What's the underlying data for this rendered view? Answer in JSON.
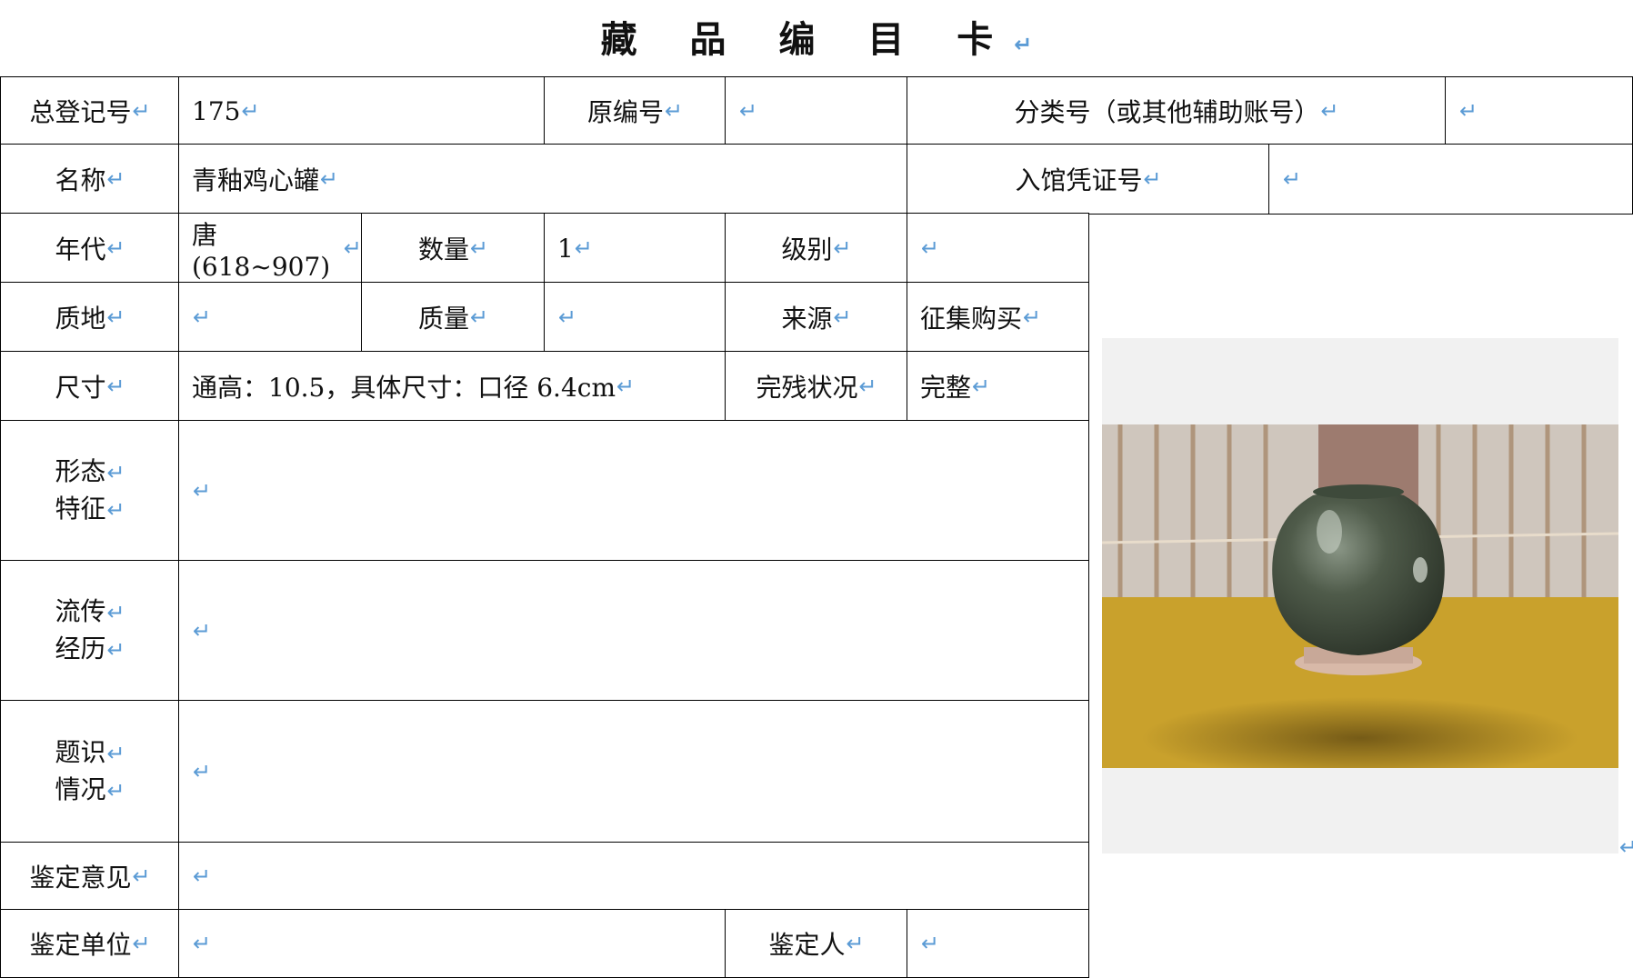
{
  "title": "藏 品 编 目 卡",
  "return_mark": "↵",
  "fields": {
    "registration_no": {
      "label": "总登记号",
      "value": "175"
    },
    "original_no": {
      "label": "原编号",
      "value": ""
    },
    "classification_no": {
      "label": "分类号（或其他辅助账号）",
      "value": ""
    },
    "name": {
      "label": "名称",
      "value": "青釉鸡心罐"
    },
    "entry_voucher_no": {
      "label": "入馆凭证号",
      "value": ""
    },
    "era": {
      "label": "年代",
      "value": "唐(618~907)"
    },
    "quantity": {
      "label": "数量",
      "value": "1"
    },
    "grade": {
      "label": "级别",
      "value": ""
    },
    "material": {
      "label": "质地",
      "value": ""
    },
    "weight": {
      "label": "质量",
      "value": ""
    },
    "source": {
      "label": "来源",
      "value": "征集购买"
    },
    "dimensions": {
      "label": "尺寸",
      "value": "通高：10.5，具体尺寸：口径 6.4cm"
    },
    "condition": {
      "label": "完残状况",
      "value": "完整"
    },
    "form_features": {
      "label_line1": "形态",
      "label_line2": "特征",
      "value": ""
    },
    "provenance": {
      "label_line1": "流传",
      "label_line2": "经历",
      "value": ""
    },
    "inscription": {
      "label_line1": "题识",
      "label_line2": "情况",
      "value": ""
    },
    "appraisal_opinion": {
      "label": "鉴定意见",
      "value": ""
    },
    "appraisal_unit": {
      "label": "鉴定单位",
      "value": ""
    },
    "appraiser": {
      "label": "鉴定人",
      "value": ""
    }
  },
  "photo": {
    "icon": "celadon-jar-photo"
  }
}
